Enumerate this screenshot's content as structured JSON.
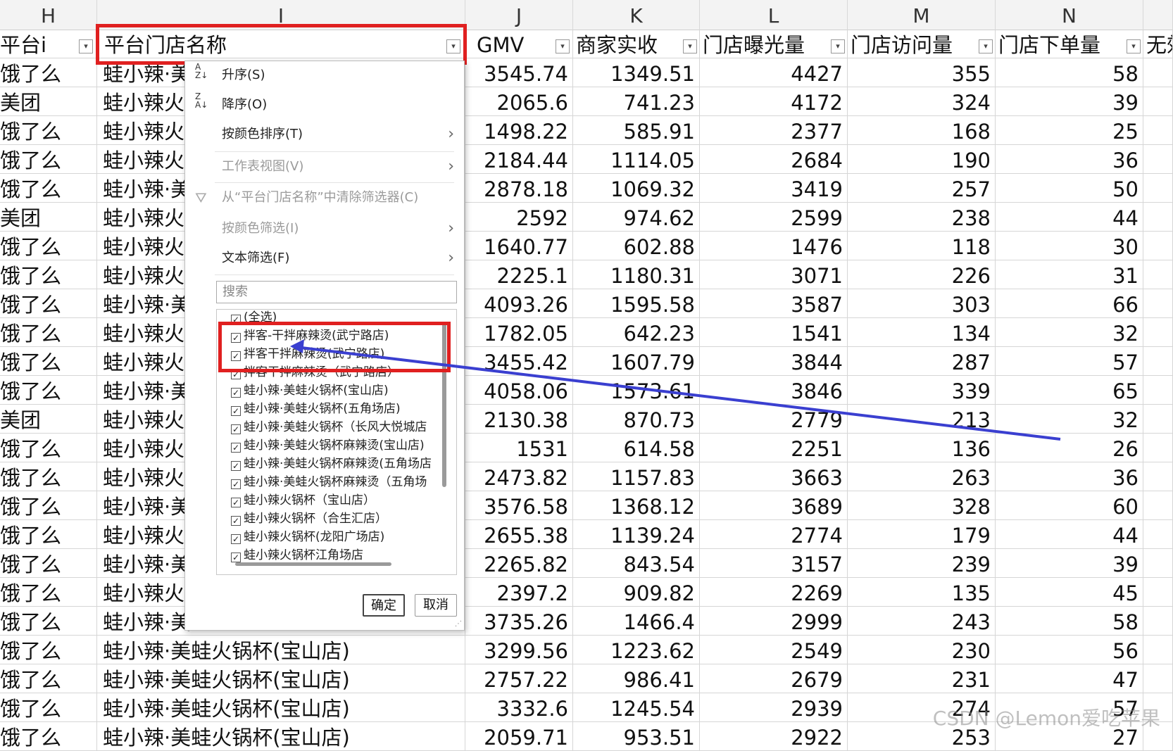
{
  "columns": [
    {
      "letter": "H",
      "header": "平台i"
    },
    {
      "letter": "I",
      "header": "平台门店名称"
    },
    {
      "letter": "J",
      "header": "GMV"
    },
    {
      "letter": "K",
      "header": "商家实收"
    },
    {
      "letter": "L",
      "header": "门店曝光量"
    },
    {
      "letter": "M",
      "header": "门店访问量"
    },
    {
      "letter": "N",
      "header": "门店下单量"
    },
    {
      "letter": "",
      "header": "无效"
    }
  ],
  "rows": [
    {
      "platform": "饿了么",
      "store": "蛙小辣·美",
      "gmv": "3545.74",
      "revenue": "1349.51",
      "exposure": "4427",
      "visits": "355",
      "orders": "58"
    },
    {
      "platform": "美团",
      "store": "蛙小辣火",
      "gmv": "2065.6",
      "revenue": "741.23",
      "exposure": "4172",
      "visits": "324",
      "orders": "39"
    },
    {
      "platform": "饿了么",
      "store": "蛙小辣火",
      "gmv": "1498.22",
      "revenue": "585.91",
      "exposure": "2377",
      "visits": "168",
      "orders": "25"
    },
    {
      "platform": "饿了么",
      "store": "蛙小辣火",
      "gmv": "2184.44",
      "revenue": "1114.05",
      "exposure": "2684",
      "visits": "190",
      "orders": "36"
    },
    {
      "platform": "饿了么",
      "store": "蛙小辣·美",
      "gmv": "2878.18",
      "revenue": "1069.32",
      "exposure": "3419",
      "visits": "257",
      "orders": "50"
    },
    {
      "platform": "美团",
      "store": "蛙小辣火",
      "gmv": "2592",
      "revenue": "974.62",
      "exposure": "2599",
      "visits": "238",
      "orders": "44"
    },
    {
      "platform": "饿了么",
      "store": "蛙小辣火",
      "gmv": "1640.77",
      "revenue": "602.88",
      "exposure": "1476",
      "visits": "118",
      "orders": "30"
    },
    {
      "platform": "饿了么",
      "store": "蛙小辣火",
      "gmv": "2225.1",
      "revenue": "1180.31",
      "exposure": "3071",
      "visits": "226",
      "orders": "31"
    },
    {
      "platform": "饿了么",
      "store": "蛙小辣·美",
      "gmv": "4093.26",
      "revenue": "1595.58",
      "exposure": "3587",
      "visits": "303",
      "orders": "66"
    },
    {
      "platform": "饿了么",
      "store": "蛙小辣火",
      "gmv": "1782.05",
      "revenue": "642.23",
      "exposure": "1541",
      "visits": "134",
      "orders": "32"
    },
    {
      "platform": "饿了么",
      "store": "蛙小辣火",
      "gmv": "3455.42",
      "revenue": "1607.79",
      "exposure": "3844",
      "visits": "287",
      "orders": "57"
    },
    {
      "platform": "饿了么",
      "store": "蛙小辣·美",
      "gmv": "4058.06",
      "revenue": "1573.61",
      "exposure": "3846",
      "visits": "339",
      "orders": "65"
    },
    {
      "platform": "美团",
      "store": "蛙小辣火",
      "gmv": "2130.38",
      "revenue": "870.73",
      "exposure": "2779",
      "visits": "213",
      "orders": "32"
    },
    {
      "platform": "饿了么",
      "store": "蛙小辣火",
      "gmv": "1531",
      "revenue": "614.58",
      "exposure": "2251",
      "visits": "136",
      "orders": "26"
    },
    {
      "platform": "饿了么",
      "store": "蛙小辣火",
      "gmv": "2473.82",
      "revenue": "1157.83",
      "exposure": "3663",
      "visits": "263",
      "orders": "36"
    },
    {
      "platform": "饿了么",
      "store": "蛙小辣·美",
      "gmv": "3576.58",
      "revenue": "1368.12",
      "exposure": "3689",
      "visits": "328",
      "orders": "60"
    },
    {
      "platform": "饿了么",
      "store": "蛙小辣火",
      "gmv": "2655.38",
      "revenue": "1139.24",
      "exposure": "2774",
      "visits": "179",
      "orders": "44"
    },
    {
      "platform": "饿了么",
      "store": "蛙小辣·美",
      "gmv": "2265.82",
      "revenue": "843.54",
      "exposure": "3157",
      "visits": "239",
      "orders": "39"
    },
    {
      "platform": "饿了么",
      "store": "蛙小辣火",
      "gmv": "2397.2",
      "revenue": "909.82",
      "exposure": "2269",
      "visits": "135",
      "orders": "45"
    },
    {
      "platform": "饿了么",
      "store": "蛙小辣·美",
      "gmv": "3735.26",
      "revenue": "1466.4",
      "exposure": "2999",
      "visits": "243",
      "orders": "58"
    },
    {
      "platform": "饿了么",
      "store": "蛙小辣·美蛙火锅杯(宝山店)",
      "gmv": "3299.56",
      "revenue": "1223.62",
      "exposure": "2549",
      "visits": "230",
      "orders": "56"
    },
    {
      "platform": "饿了么",
      "store": "蛙小辣·美蛙火锅杯(宝山店)",
      "gmv": "2757.22",
      "revenue": "986.41",
      "exposure": "2679",
      "visits": "231",
      "orders": "47"
    },
    {
      "platform": "饿了么",
      "store": "蛙小辣·美蛙火锅杯(宝山店)",
      "gmv": "3332.6",
      "revenue": "1245.54",
      "exposure": "2939",
      "visits": "274",
      "orders": "57"
    },
    {
      "platform": "饿了么",
      "store": "蛙小辣·美蛙火锅杯(宝山店)",
      "gmv": "2059.71",
      "revenue": "953.51",
      "exposure": "2922",
      "visits": "253",
      "orders": "27"
    }
  ],
  "dropdown": {
    "sort_asc": "升序(S)",
    "sort_desc": "降序(O)",
    "sort_by_color": "按颜色排序(T)",
    "sheet_view": "工作表视图(V)",
    "clear_filter": "从“平台门店名称”中清除筛选器(C)",
    "filter_by_color": "按颜色筛选(I)",
    "text_filter": "文本筛选(F)",
    "search_placeholder": "搜索",
    "items": [
      "(全选)",
      "拌客-干拌麻辣烫(武宁路店)",
      "拌客干拌麻辣烫(武宁路店)",
      "拌客干拌麻辣烫（武宁路店）",
      "蛙小辣·美蛙火锅杯(宝山店)",
      "蛙小辣·美蛙火锅杯(五角场店)",
      "蛙小辣·美蛙火锅杯（长风大悦城店",
      "蛙小辣·美蛙火锅杯麻辣烫(宝山店)",
      "蛙小辣·美蛙火锅杯麻辣烫(五角场店",
      "蛙小辣·美蛙火锅杯麻辣烫（五角场",
      "蛙小辣火锅杯（宝山店）",
      "蛙小辣火锅杯（合生汇店）",
      "蛙小辣火锅杯(龙阳广场店)",
      "蛙小辣火锅杯江角场店"
    ],
    "ok": "确定",
    "cancel": "取消"
  },
  "watermark": "CSDN @Lemon爱吃苹果",
  "colors": {
    "annotation_red": "#e02020",
    "arrow_blue": "#3a3fd0"
  }
}
